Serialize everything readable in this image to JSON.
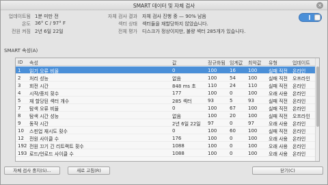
{
  "window": {
    "title": "SMART 데이터 및 자체 검사"
  },
  "info": {
    "left": [
      {
        "label": "업데이트됨",
        "value": "1분 미만 전"
      },
      {
        "label": "온도",
        "value": "36° C / 97° F"
      },
      {
        "label": "전원 켜짐",
        "value": "2년 6일 22일"
      }
    ],
    "right": [
      {
        "label": "자체 검사 결과",
        "value": "자체 검사 진행 중 — 90% 남음"
      },
      {
        "label": "섹터 상태",
        "value": "섹터들을 재할당하지 않았습니다."
      },
      {
        "label": "전체 평가",
        "value": "디스크가 정상이지만, 불량 섹터 285개가 있습니다."
      }
    ]
  },
  "smart_toggle": {
    "state": "on"
  },
  "section": {
    "title": "SMART 속성(A)"
  },
  "table": {
    "headers": {
      "id": "ID",
      "attribute": "속성",
      "value": "값",
      "normalized": "정규화됨",
      "threshold": "임계값",
      "worst": "최악값",
      "type": "유형",
      "updates": "업데이트",
      "assessment": "평가"
    },
    "rows": [
      {
        "id": "1",
        "attribute": "읽기 오류 비율",
        "value": "0",
        "normalized": "100",
        "threshold": "16",
        "worst": "100",
        "type": "실패 직전",
        "updates": "온라인",
        "assessment": "정상함",
        "selected": true
      },
      {
        "id": "2",
        "attribute": "처리 성능",
        "value": "없음",
        "normalized": "100",
        "threshold": "54",
        "worst": "100",
        "type": "실패 직전",
        "updates": "오프라인",
        "assessment": "정상함"
      },
      {
        "id": "3",
        "attribute": "회전 시간",
        "value": "848 ms 초",
        "normalized": "110",
        "threshold": "24",
        "worst": "110",
        "type": "실패 직전",
        "updates": "온라인",
        "assessment": "정상함"
      },
      {
        "id": "4",
        "attribute": "시작/중지 횟수",
        "value": "177",
        "normalized": "100",
        "threshold": "0",
        "worst": "100",
        "type": "오래 사용",
        "updates": "온라인",
        "assessment": "정상함"
      },
      {
        "id": "5",
        "attribute": "재 할당된 섹터 개수",
        "value": "285 섹터",
        "normalized": "93",
        "threshold": "5",
        "worst": "93",
        "type": "실패 직전",
        "updates": "온라인",
        "assessment": "정상함"
      },
      {
        "id": "7",
        "attribute": "탐색 오류 비율",
        "value": "0",
        "normalized": "100",
        "threshold": "67",
        "worst": "100",
        "type": "실패 직전",
        "updates": "온라인",
        "assessment": "정상함"
      },
      {
        "id": "8",
        "attribute": "탐색 시간 성능",
        "value": "없음",
        "normalized": "100",
        "threshold": "20",
        "worst": "100",
        "type": "실패 직전",
        "updates": "오프라인",
        "assessment": "정상함"
      },
      {
        "id": "9",
        "attribute": "동작 시간",
        "value": "2년 6일 22일",
        "normalized": "97",
        "threshold": "0",
        "worst": "97",
        "type": "오래 사용",
        "updates": "온라인",
        "assessment": "정상함"
      },
      {
        "id": "10",
        "attribute": "스핀업 재시도 횟수",
        "value": "0",
        "normalized": "100",
        "threshold": "60",
        "worst": "100",
        "type": "실패 직전",
        "updates": "온라인",
        "assessment": "정상함"
      },
      {
        "id": "12",
        "attribute": "전원 사이클 수",
        "value": "176",
        "normalized": "100",
        "threshold": "0",
        "worst": "100",
        "type": "오래 사용",
        "updates": "온라인",
        "assessment": "정상함"
      },
      {
        "id": "192",
        "attribute": "전원 끄기 긴 리트랙트 횟수",
        "value": "1088",
        "normalized": "100",
        "threshold": "0",
        "worst": "100",
        "type": "오래 사용",
        "updates": "온라인",
        "assessment": "정상함"
      },
      {
        "id": "193",
        "attribute": "로드/언로드 사이클 수",
        "value": "1088",
        "normalized": "100",
        "threshold": "0",
        "worst": "100",
        "type": "오래 사용",
        "updates": "온라인",
        "assessment": "정상함"
      }
    ]
  },
  "buttons": {
    "self_test": "자체 검사 중지(S)...",
    "refresh": "새로 고침(R)",
    "close": "닫기(C)"
  }
}
